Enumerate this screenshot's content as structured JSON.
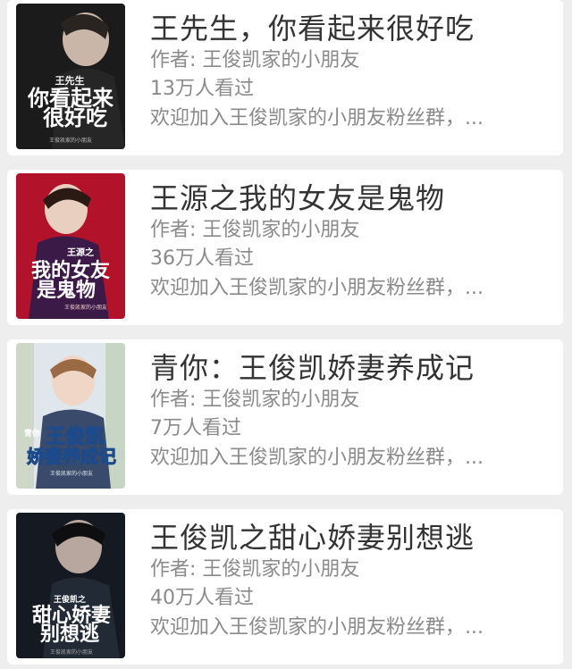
{
  "books": [
    {
      "title": "王先生，你看起来很好吃",
      "author": "作者: 王俊凯家的小朋友",
      "views": "13万人看过",
      "desc": "欢迎加入王俊凯家的小朋友粉丝群，...",
      "cover_title_line1": "你看起来",
      "cover_title_line2": "很好吃",
      "cover_tag": "王先生",
      "cover_author": "王俊凯家的小朋友",
      "cover_bg": "#1b1b1b"
    },
    {
      "title": "王源之我的女友是鬼物",
      "author": "作者: 王俊凯家的小朋友",
      "views": "36万人看过",
      "desc": "欢迎加入王俊凯家的小朋友粉丝群，...",
      "cover_title_line1": "我的女友",
      "cover_title_line2": "是鬼物",
      "cover_tag": "王源之",
      "cover_author": "王俊凯家的小朋友",
      "cover_bg": "#b3132a"
    },
    {
      "title": "青你：王俊凯娇妻养成记",
      "author": "作者: 王俊凯家的小朋友",
      "views": "7万人看过",
      "desc": "欢迎加入王俊凯家的小朋友粉丝群，...",
      "cover_title_line1": "王俊凯",
      "cover_title_line2": "娇妻养成记",
      "cover_tag": "青你",
      "cover_author": "王俊凯家的小朋友",
      "cover_bg": "#dfe7ec"
    },
    {
      "title": "王俊凯之甜心娇妻别想逃",
      "author": "作者: 王俊凯家的小朋友",
      "views": "40万人看过",
      "desc": "欢迎加入王俊凯家的小朋友粉丝群，...",
      "cover_title_line1": "甜心娇妻",
      "cover_title_line2": "别想逃",
      "cover_tag": "王俊凯之",
      "cover_author": "王俊凯家的小朋友",
      "cover_bg": "#151a22"
    }
  ]
}
